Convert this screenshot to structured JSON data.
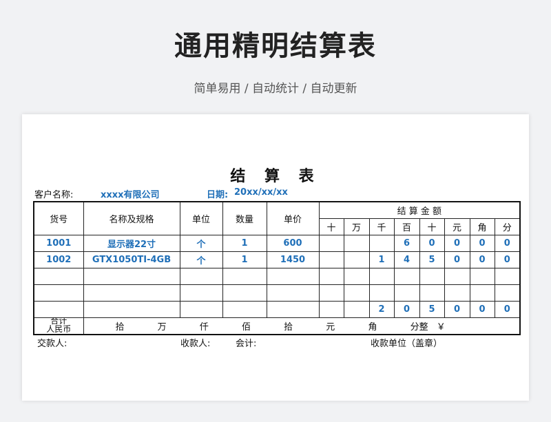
{
  "hero": {
    "title": "通用精明结算表",
    "subtitle": "简单易用 / 自动统计 / 自动更新"
  },
  "document": {
    "title": "结 算 表",
    "customer_label": "客户名称:",
    "customer_value": "xxxx有限公司",
    "date_label": "日期:",
    "date_value": "20xx/xx/xx"
  },
  "table": {
    "headers": {
      "code": "货号",
      "name": "名称及规格",
      "unit": "单位",
      "qty": "数量",
      "price": "单价",
      "amount": "结 算 金 额"
    },
    "digit_headers": [
      "十",
      "万",
      "千",
      "百",
      "十",
      "元",
      "角",
      "分"
    ],
    "rows": [
      {
        "code": "1001",
        "name": "显示器22寸",
        "unit": "个",
        "qty": "1",
        "price": "600",
        "digits": [
          "",
          "",
          "",
          "6",
          "0",
          "0",
          "0",
          "0"
        ]
      },
      {
        "code": "1002",
        "name": "GTX1050TI-4GB",
        "unit": "个",
        "qty": "1",
        "price": "1450",
        "digits": [
          "",
          "",
          "1",
          "4",
          "5",
          "0",
          "0",
          "0"
        ]
      },
      {
        "code": "",
        "name": "",
        "unit": "",
        "qty": "",
        "price": "",
        "digits": [
          "",
          "",
          "",
          "",
          "",
          "",
          "",
          ""
        ]
      },
      {
        "code": "",
        "name": "",
        "unit": "",
        "qty": "",
        "price": "",
        "digits": [
          "",
          "",
          "",
          "",
          "",
          "",
          "",
          ""
        ]
      }
    ],
    "total_digits": [
      "",
      "",
      "2",
      "0",
      "5",
      "0",
      "0",
      "0"
    ],
    "total_label_line1": "合计",
    "total_label_line2": "人民币",
    "daxie_units": [
      "拾",
      "万",
      "仟",
      "佰",
      "拾",
      "元",
      "角",
      "分整",
      "￥"
    ]
  },
  "signatures": {
    "payer": "交款人:",
    "payee": "收款人:",
    "accountant": "会计:",
    "receiving_unit": "收款单位（盖章）"
  }
}
